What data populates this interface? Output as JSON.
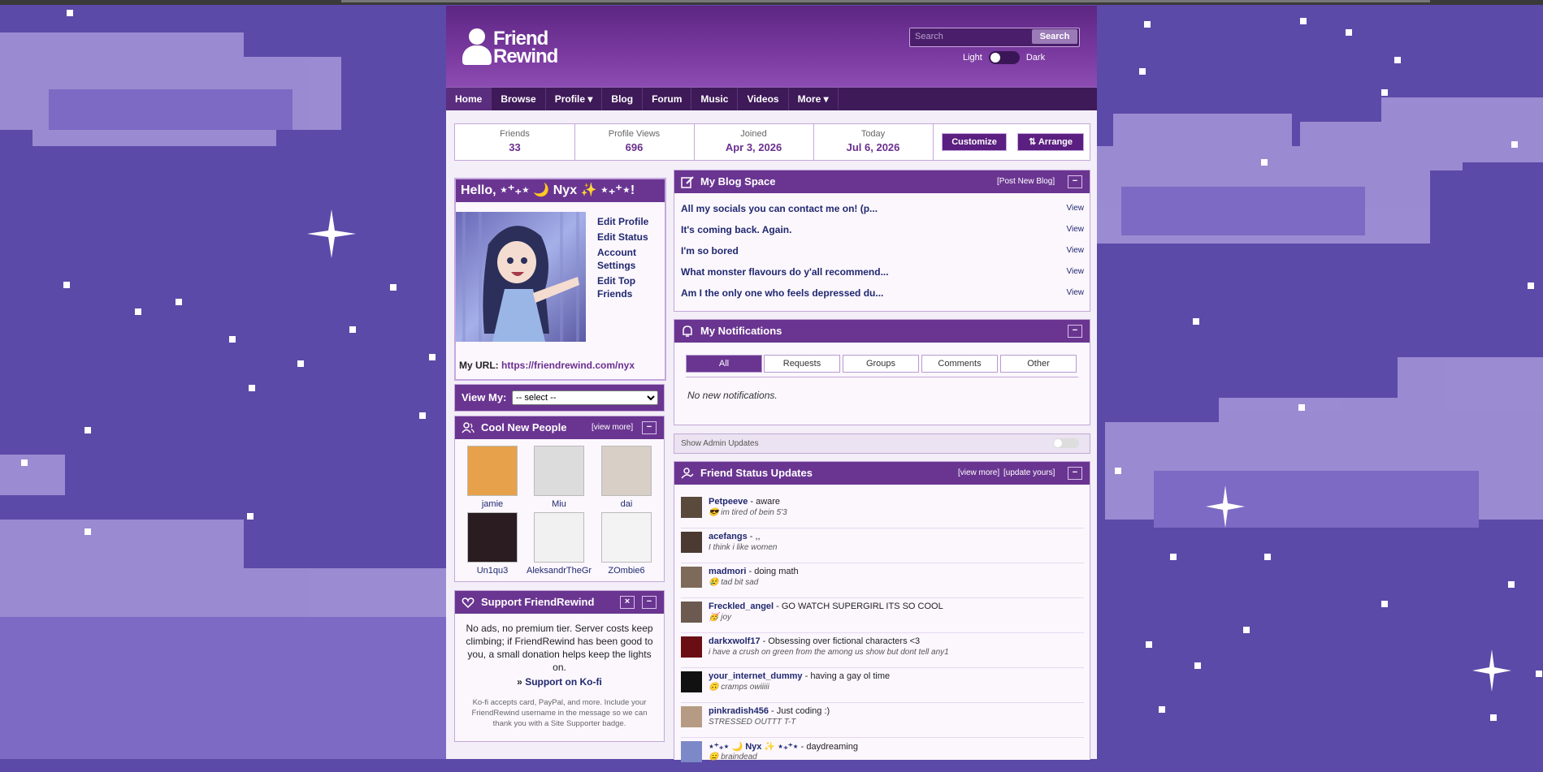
{
  "header": {
    "logo_line1": "Friend",
    "logo_line2": "Rewind",
    "search_placeholder": "Search",
    "search_button": "Search",
    "theme_light": "Light",
    "theme_dark": "Dark"
  },
  "nav": [
    "Home",
    "Browse",
    "Profile ▾",
    "Blog",
    "Forum",
    "Music",
    "Videos",
    "More ▾"
  ],
  "stats": [
    {
      "label": "Friends",
      "value": "33"
    },
    {
      "label": "Profile Views",
      "value": "696"
    },
    {
      "label": "Joined",
      "value": "Apr 3, 2026"
    },
    {
      "label": "Today",
      "value": "Jul 6, 2026"
    }
  ],
  "actions": {
    "customize": "Customize",
    "arrange": "⇅ Arrange"
  },
  "hello": {
    "title": "Hello, ⋆⁺₊⋆ 🌙 Nyx ✨ ⋆₊⁺⋆!",
    "links": [
      "Edit Profile",
      "Edit Status",
      "Account Settings",
      "Edit Top Friends"
    ],
    "url_label": "My URL:",
    "url": "https://friendrewind.com/nyx"
  },
  "view_my": {
    "label": "View My:",
    "selected": "-- select --"
  },
  "cool_people": {
    "title": "Cool New People",
    "view_more": "[view more]",
    "people": [
      "jamie",
      "Miu",
      "dai",
      "Un1qu3",
      "AleksandrTheGre",
      "ZOmbie6"
    ],
    "colors": [
      "#e7a14b",
      "#dcdcdc",
      "#d8cfc6",
      "#2a1c20",
      "#f1f1f1",
      "#f3f3f3"
    ]
  },
  "support": {
    "title": "Support FriendRewind",
    "body": "No ads, no premium tier. Server costs keep climbing; if FriendRewind has been good to you, a small donation helps keep the lights on.",
    "link_prefix": "» ",
    "link": "Support on Ko-fi",
    "fine": "Ko-fi accepts card, PayPal, and more. Include your FriendRewind username in the message so we can thank you with a Site Supporter badge."
  },
  "blog": {
    "title": "My Blog Space",
    "post_new": "[Post New Blog]",
    "view_label": "View",
    "entries": [
      "All my socials you can contact me on! (p...",
      "It's coming back. Again.",
      "I'm so bored",
      "What monster flavours do y'all recommend...",
      "Am I the only one who feels depressed du..."
    ]
  },
  "notifications": {
    "title": "My Notifications",
    "tabs": [
      "All",
      "Requests",
      "Groups",
      "Comments",
      "Other"
    ],
    "empty": "No new notifications."
  },
  "admin": {
    "label": "Show Admin Updates"
  },
  "status_updates": {
    "title": "Friend Status Updates",
    "view_more": "[view more]",
    "update_yours": "[update yours]",
    "items": [
      {
        "name": "Petpeeve",
        "status": "- aware",
        "mood": "😎 im tired of bein 5'3",
        "color": "#5a4a3c"
      },
      {
        "name": "acefangs",
        "status": "- ,,",
        "mood": "I think i like women",
        "color": "#4a3a32"
      },
      {
        "name": "madmori",
        "status": "- doing math",
        "mood": "😢 tad bit sad",
        "color": "#7d6a5a"
      },
      {
        "name": "Freckled_angel",
        "status": "- GO WATCH SUPERGIRL ITS SO COOL",
        "mood": "🥳 joy",
        "color": "#6c5a50"
      },
      {
        "name": "darkxwolf17",
        "status": "- Obsessing over fictional characters <3",
        "mood": "i have a crush on green from the among us show but dont tell any1",
        "color": "#6a0e14"
      },
      {
        "name": "your_internet_dummy",
        "status": "- having a gay ol time",
        "mood": "🙃 cramps owiiiii",
        "color": "#111111"
      },
      {
        "name": "pinkradish456",
        "status": "- Just coding :)",
        "mood": "STRESSED OUTTT T-T",
        "color": "#b59a84"
      },
      {
        "name": "⋆⁺₊⋆ 🌙 Nyx ✨ ⋆₊⁺⋆",
        "status": "- daydreaming",
        "mood": "😑 braindead",
        "color": "#7d88c8"
      }
    ]
  }
}
